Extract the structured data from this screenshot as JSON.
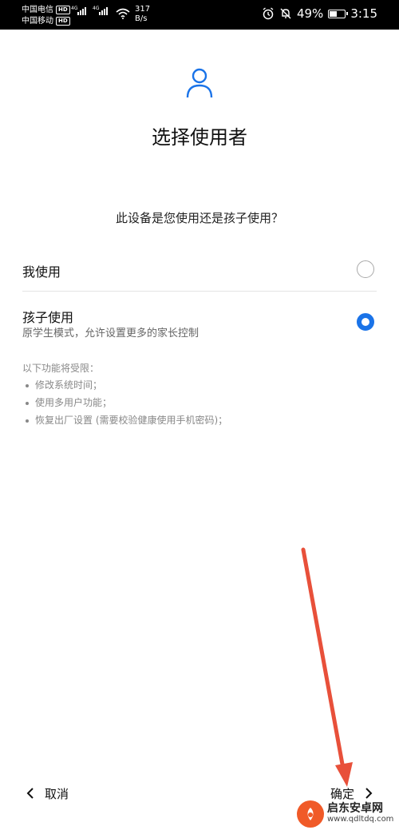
{
  "status_bar": {
    "carrier1": "中国电信",
    "carrier2": "中国移动",
    "hd_badge": "HD",
    "network1": "4G",
    "network2": "4G",
    "speed_value": "317",
    "speed_unit": "B/s",
    "battery": "49%",
    "time": "3:15"
  },
  "header": {
    "title": "选择使用者",
    "icon": "user-icon"
  },
  "question": "此设备是您使用还是孩子使用？",
  "options": [
    {
      "label": "我使用",
      "selected": false
    },
    {
      "label": "孩子使用",
      "description": "原学生模式，允许设置更多的家长控制",
      "selected": true
    }
  ],
  "restrictions": {
    "title": "以下功能将受限：",
    "items": [
      "修改系统时间；",
      "使用多用户功能；",
      "恢复出厂设置 (需要校验健康使用手机密码)；"
    ]
  },
  "bottom_nav": {
    "cancel_label": "取消",
    "confirm_label": "确定"
  },
  "watermark": {
    "name": "启东安卓网",
    "url": "www.qdltdq.com"
  },
  "colors": {
    "accent": "#1a73e8",
    "annotation": "#e8503a"
  }
}
